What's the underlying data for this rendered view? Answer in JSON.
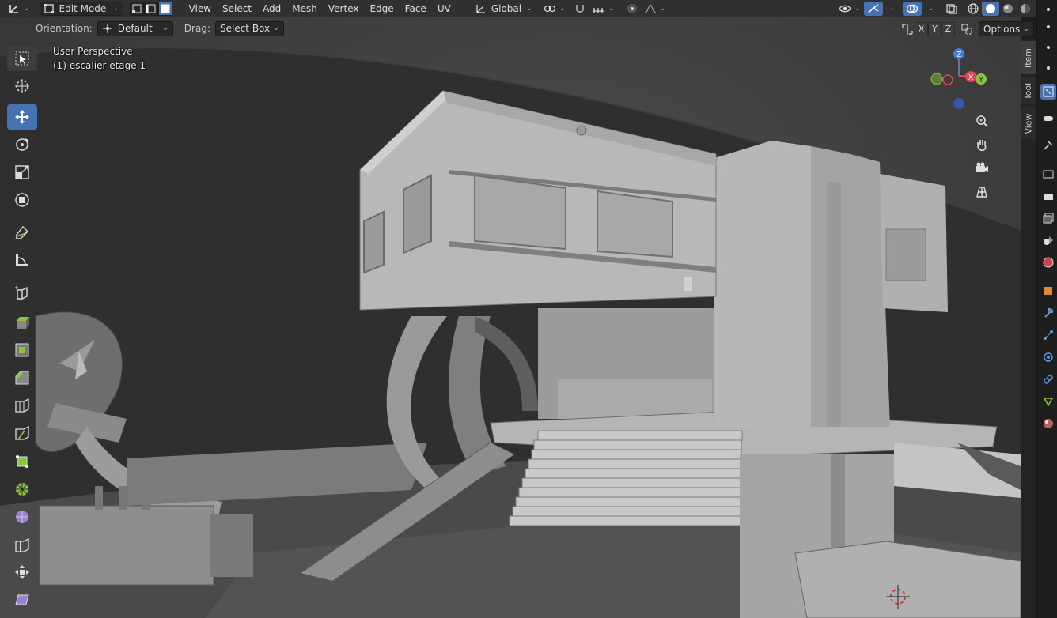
{
  "header": {
    "mode": "Edit Mode",
    "menus": [
      "View",
      "Select",
      "Add",
      "Mesh",
      "Vertex",
      "Edge",
      "Face",
      "UV"
    ],
    "transform_orientation": "Global"
  },
  "tool_settings": {
    "orientation_label": "Orientation:",
    "orientation_value": "Default",
    "drag_label": "Drag:",
    "drag_value": "Select Box",
    "mirror_x": "X",
    "mirror_y": "Y",
    "mirror_z": "Z",
    "options_label": "Options"
  },
  "viewport": {
    "view_name": "User Perspective",
    "object_info": "(1) escalier etage 1"
  },
  "gizmo": {
    "z": "Z",
    "x": "X",
    "y": "Y"
  },
  "sidebar_tabs": [
    "Item",
    "Tool",
    "View"
  ],
  "colors": {
    "accent": "#4772b3",
    "header_bg": "#303030",
    "axis_x": "#e84656",
    "axis_y": "#8bc43f",
    "axis_z": "#3d7fdb"
  }
}
